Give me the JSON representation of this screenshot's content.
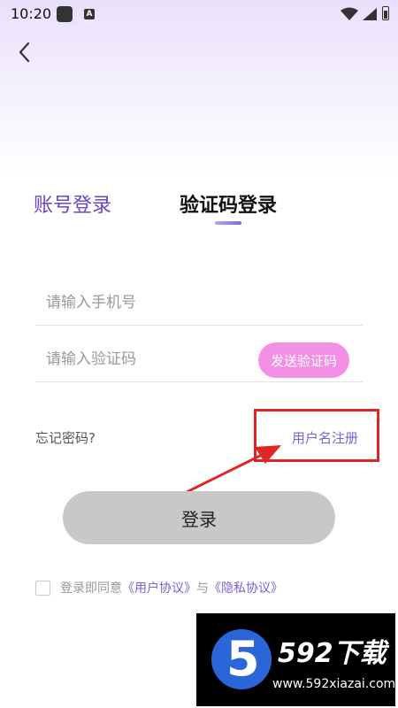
{
  "status_bar": {
    "time": "10:20",
    "icons": [
      "app-icon",
      "a-notification-icon",
      "wifi-icon",
      "signal-icon",
      "battery-icon"
    ]
  },
  "nav": {
    "back_icon": "chevron-left-icon"
  },
  "tabs": [
    {
      "label": "账号登录",
      "active": false
    },
    {
      "label": "验证码登录",
      "active": true
    }
  ],
  "form": {
    "phone_placeholder": "请输入手机号",
    "code_placeholder": "请输入验证码",
    "send_code_label": "发送验证码"
  },
  "links": {
    "forgot_password": "忘记密码?",
    "register": "用户名注册"
  },
  "login_button": "登录",
  "agreement": {
    "prefix": "登录即同意",
    "user_agreement": "《用户协议》",
    "joiner": "与",
    "privacy_policy": "《隐私协议》"
  },
  "watermark": {
    "logo_digit": "5",
    "title": "592下载",
    "url": "www.592xiazai.com"
  },
  "colors": {
    "accent": "#7d5fd6",
    "send_button": "#f48fe6",
    "login_button": "#c8c8c8",
    "annotation": "#e02525"
  }
}
